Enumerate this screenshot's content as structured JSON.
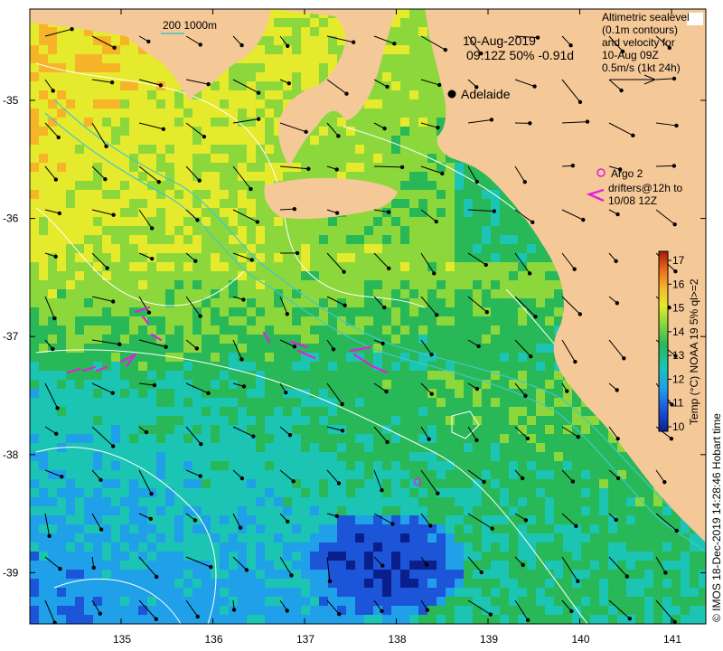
{
  "map": {
    "date": "10-Aug-2019",
    "time_info": "09:12Z  50% -0.91d",
    "scale_label": "200  1000m",
    "city": "Adelaide",
    "legend_sealevel": [
      "Altimetric sealevel",
      "(0.1m contours)",
      "and velocity for",
      "10-Aug 09Z",
      "0.5m/s (1kt 24h)"
    ],
    "legend_argo": "Argo 2",
    "legend_drifters": [
      "drifters@12h to",
      "10/08 12Z"
    ],
    "colorbar_title": "Temp (°C) NOAA 19 5% ql>=2",
    "colorbar_ticks": [
      "10",
      "11",
      "12",
      "13",
      "14",
      "15",
      "16",
      "17"
    ],
    "credit": "© IMOS 18-Dec-2019 14:28:46 Hobart time",
    "lon_ticks": [
      "135",
      "136",
      "137",
      "138",
      "139",
      "140",
      "141"
    ],
    "lat_ticks": [
      "-35",
      "-36",
      "-37",
      "-38",
      "-39"
    ],
    "colors": {
      "land": "#f5c898",
      "arrow": "#000000",
      "drifter": "#e020e0",
      "contour": "#ffffff",
      "isobath": "#40c8c8"
    }
  }
}
